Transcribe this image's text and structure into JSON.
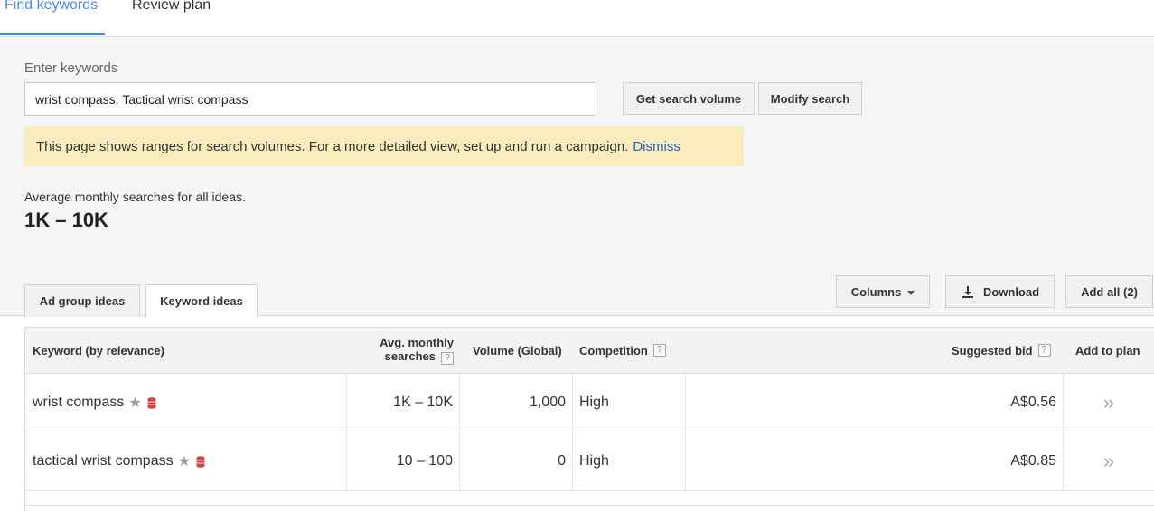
{
  "top_tabs": {
    "find": "Find keywords",
    "review": "Review plan"
  },
  "search": {
    "label": "Enter keywords",
    "value": "wrist compass, Tactical wrist compass",
    "get_volume_label": "Get search volume",
    "modify_label": "Modify search"
  },
  "notice": {
    "text": "This page shows ranges for search volumes. For a more detailed view, set up and run a campaign.",
    "dismiss": "Dismiss"
  },
  "summary": {
    "label": "Average monthly searches for all ideas.",
    "value": "1K – 10K"
  },
  "idea_tabs": {
    "ad_group": "Ad group ideas",
    "keyword": "Keyword ideas"
  },
  "toolbar": {
    "columns": "Columns",
    "download": "Download",
    "add_all": "Add all (2)"
  },
  "table": {
    "headers": {
      "keyword": "Keyword (by relevance)",
      "avg_line1": "Avg. monthly",
      "avg_line2": "searches",
      "volume": "Volume (Global)",
      "competition": "Competition",
      "bid": "Suggested bid",
      "add": "Add to plan"
    },
    "help_glyph": "?",
    "add_glyph": "»",
    "rows": [
      {
        "keyword": "wrist compass",
        "avg": "1K – 10K",
        "volume": "1,000",
        "competition": "High",
        "bid": "A$0.56"
      },
      {
        "keyword": "tactical wrist compass",
        "avg": "10 – 100",
        "volume": "0",
        "competition": "High",
        "bid": "A$0.85"
      }
    ]
  },
  "colors": {
    "accent": "#4a86e8",
    "notice_bg": "#f9edbe",
    "link": "#2962c4",
    "db_icon": "#d9413c"
  }
}
